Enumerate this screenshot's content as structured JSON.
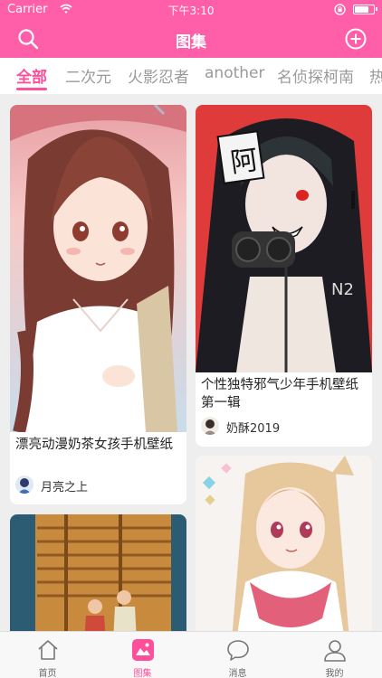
{
  "status_bar": {
    "carrier": "Carrier",
    "time": "下午3:10",
    "battery_level": 0.8
  },
  "nav": {
    "title": "图集"
  },
  "tabs": [
    {
      "label": "全部",
      "active": true
    },
    {
      "label": "二次元"
    },
    {
      "label": "火影忍者"
    },
    {
      "label": "another"
    },
    {
      "label": "名侦探柯南"
    },
    {
      "label": "热"
    }
  ],
  "cards": [
    {
      "title": "漂亮动漫奶茶女孩手机壁纸",
      "author": "月亮之上"
    },
    {
      "title": "个性独特邪气少年手机壁纸 第一辑",
      "author": "奶酥2019"
    },
    {
      "title": "",
      "author": ""
    },
    {
      "title": "",
      "author": ""
    }
  ],
  "artwork_text": {
    "kanji": "阿",
    "jacket": "N2"
  },
  "tab_bar": [
    {
      "label": "首页",
      "icon": "home-icon"
    },
    {
      "label": "图集",
      "icon": "gallery-icon",
      "active": true
    },
    {
      "label": "消息",
      "icon": "message-icon"
    },
    {
      "label": "我的",
      "icon": "profile-icon"
    }
  ],
  "colors": {
    "brand": "#ff5fa8",
    "active_tab": "#ff4f9a"
  }
}
